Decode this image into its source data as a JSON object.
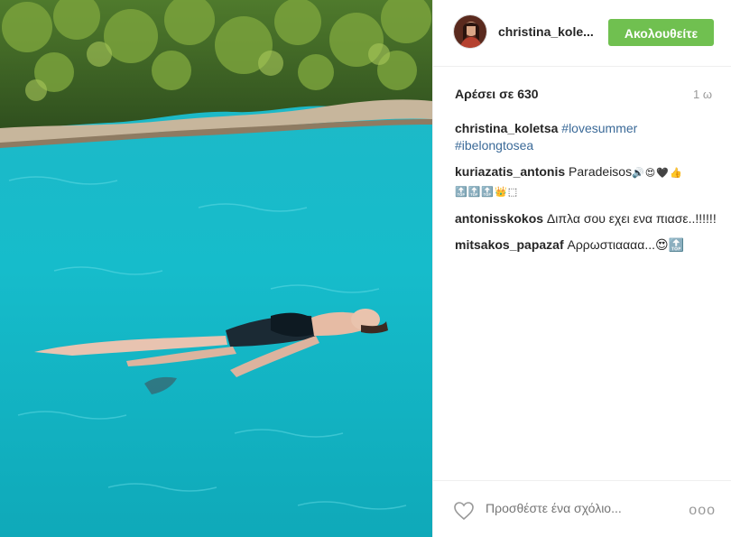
{
  "post": {
    "username": "christina_kole...",
    "follow_label": "Ακολουθείτε",
    "likes": "Αρέσει σε 630",
    "time": "1 ω"
  },
  "caption": {
    "user": "christina_koletsa",
    "tags": [
      "#lovesummer",
      "#ibelongtosea"
    ]
  },
  "comments": [
    {
      "user": "kuriazatis_antonis",
      "text": "Paradeisos",
      "emoji": "🔊😍🖤👍 🔝🔝🔝👑⬚"
    },
    {
      "user": "antonisskokos",
      "text": "Διπλα σου εχει ενα πιασε..!!!!!!"
    },
    {
      "user": "mitsakos_papazaf",
      "text": "Αρρωστιαααα...😍🔝"
    }
  ],
  "footer": {
    "comment_placeholder": "Προσθέστε ένα σχόλιο...",
    "more_label": "ooo"
  },
  "colors": {
    "follow": "#70c050",
    "hashtag": "#3b6a98",
    "sea": "#1fb8c8"
  },
  "icons": {
    "heart": "heart-icon",
    "more": "more-options-icon"
  }
}
